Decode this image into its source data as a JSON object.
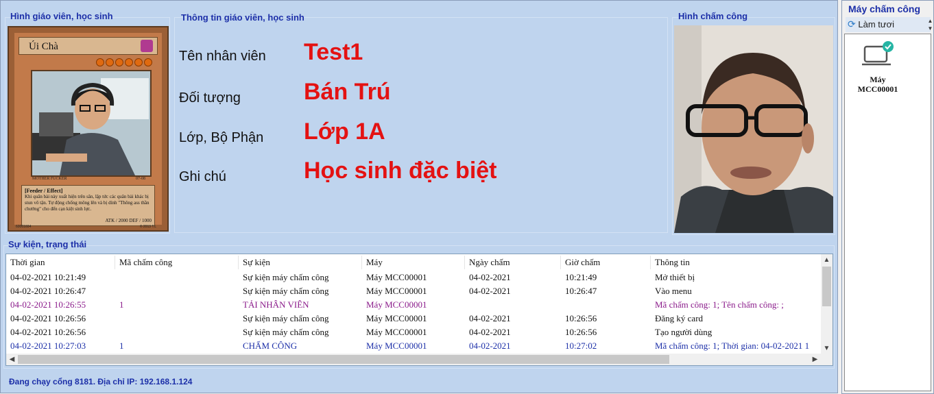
{
  "photo_group": {
    "title": "Hình giáo viên, học sinh"
  },
  "card": {
    "name": "Úi Chà",
    "caption_left": "MOTHER FUCKER",
    "caption_right": "07-08",
    "type_line": "[Feeder / Effect]",
    "effect": "Khi quân bài này xuất hiện trên sân, lập tức các quân bài khác bị stun vô tận. Tự động chống mông lên và bị dính \"Thông ass thần chưởng\" cho đến cạn kiệt sinh lực.",
    "atk_def": "ATK / 2000  DEF / 1000",
    "serial": "60001604",
    "copyright": "© 2013 T.L"
  },
  "info_group": {
    "title": "Thông tin giáo viên, học sinh",
    "rows": [
      {
        "label": "Tên nhân viên",
        "value": "Test1"
      },
      {
        "label": "Đối tượng",
        "value": "Bán Trú"
      },
      {
        "label": "Lớp, Bộ Phận",
        "value": "Lớp 1A"
      },
      {
        "label": "Ghi chú",
        "value": "Học sinh đặc biệt"
      }
    ]
  },
  "attendance_photo": {
    "title": "Hình chấm công"
  },
  "events": {
    "title": "Sự kiện, trạng thái",
    "columns": [
      "Thời gian",
      "Mã chấm công",
      "Sự kiện",
      "Máy",
      "Ngày chấm",
      "Giờ chấm",
      "Thông tin"
    ],
    "rows": [
      {
        "color": "#111111",
        "cells": [
          "04-02-2021 10:21:49",
          "",
          "Sự kiện máy chấm công",
          "Máy MCC00001",
          "04-02-2021",
          "10:21:49",
          "Mở thiết bị"
        ]
      },
      {
        "color": "#111111",
        "cells": [
          "04-02-2021 10:26:47",
          "",
          "Sự kiện máy chấm công",
          "Máy MCC00001",
          "04-02-2021",
          "10:26:47",
          "Vào menu"
        ]
      },
      {
        "color": "#8a1a8a",
        "cells": [
          "04-02-2021 10:26:55",
          "1",
          "TẢI NHÂN VIÊN",
          "Máy MCC00001",
          "",
          "",
          "Mã chấm công: 1; Tên chấm công: ;"
        ]
      },
      {
        "color": "#111111",
        "cells": [
          "04-02-2021 10:26:56",
          "",
          "Sự kiện máy chấm công",
          "Máy MCC00001",
          "04-02-2021",
          "10:26:56",
          "Đăng ký card"
        ]
      },
      {
        "color": "#111111",
        "cells": [
          "04-02-2021 10:26:56",
          "",
          "Sự kiện máy chấm công",
          "Máy MCC00001",
          "04-02-2021",
          "10:26:56",
          "Tạo người dùng"
        ]
      },
      {
        "color": "#1c2fa8",
        "cells": [
          "04-02-2021 10:27:03",
          "1",
          "CHẤM CÔNG",
          "Máy MCC00001",
          "04-02-2021",
          "10:27:02",
          "Mã chấm công: 1; Thời gian: 04-02-2021 1"
        ]
      }
    ]
  },
  "status_bar": {
    "text": "Đang chạy cổng 8181. Địa chỉ IP: 192.168.1.124"
  },
  "side_panel": {
    "title": "Máy chấm công",
    "refresh_label": "Làm tươi",
    "devices": [
      {
        "name_line1": "Máy",
        "name_line2": "MCC00001",
        "status": "connected"
      }
    ]
  },
  "colors": {
    "accent_title": "#1c2fa8",
    "value_red": "#e41212",
    "panel_bg": "#bfd4ee",
    "check_teal": "#26b5a4"
  }
}
